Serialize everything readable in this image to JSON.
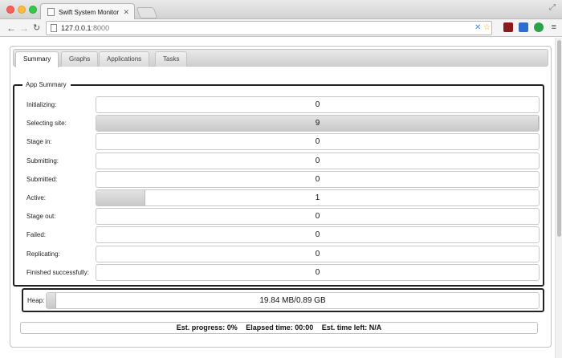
{
  "browser": {
    "tab_title": "Swift System Monitor",
    "url_host": "127.0.0.1",
    "url_port": ":8000"
  },
  "app_tabs": [
    {
      "label": "Summary",
      "active": true
    },
    {
      "label": "Graphs",
      "active": false
    },
    {
      "label": "Applications",
      "active": false
    },
    {
      "label": "Tasks",
      "active": false
    }
  ],
  "summary": {
    "legend": "App Summary",
    "stats": [
      {
        "label": "Initializing:",
        "value": "0",
        "fill_fraction": 0
      },
      {
        "label": "Selecting site:",
        "value": "9",
        "fill_fraction": 1
      },
      {
        "label": "Stage in:",
        "value": "0",
        "fill_fraction": 0
      },
      {
        "label": "Submitting:",
        "value": "0",
        "fill_fraction": 0
      },
      {
        "label": "Submitted:",
        "value": "0",
        "fill_fraction": 0
      },
      {
        "label": "Active:",
        "value": "1",
        "fill_fraction": 0.11
      },
      {
        "label": "Stage out:",
        "value": "0",
        "fill_fraction": 0
      },
      {
        "label": "Failed:",
        "value": "0",
        "fill_fraction": 0
      },
      {
        "label": "Replicating:",
        "value": "0",
        "fill_fraction": 0
      },
      {
        "label": "Finished successfully:",
        "value": "0",
        "fill_fraction": 0
      }
    ]
  },
  "heap": {
    "label": "Heap:",
    "value": "19.84 MB/0.89 GB",
    "fill_fraction": 0.02
  },
  "progress": {
    "est_progress": "Est. progress: 0%",
    "elapsed": "Elapsed time: 00:00",
    "time_left": "Est. time left: N/A"
  },
  "colors": {
    "bar_fill": "#d2d2d2",
    "fieldset_border": "#222222"
  }
}
